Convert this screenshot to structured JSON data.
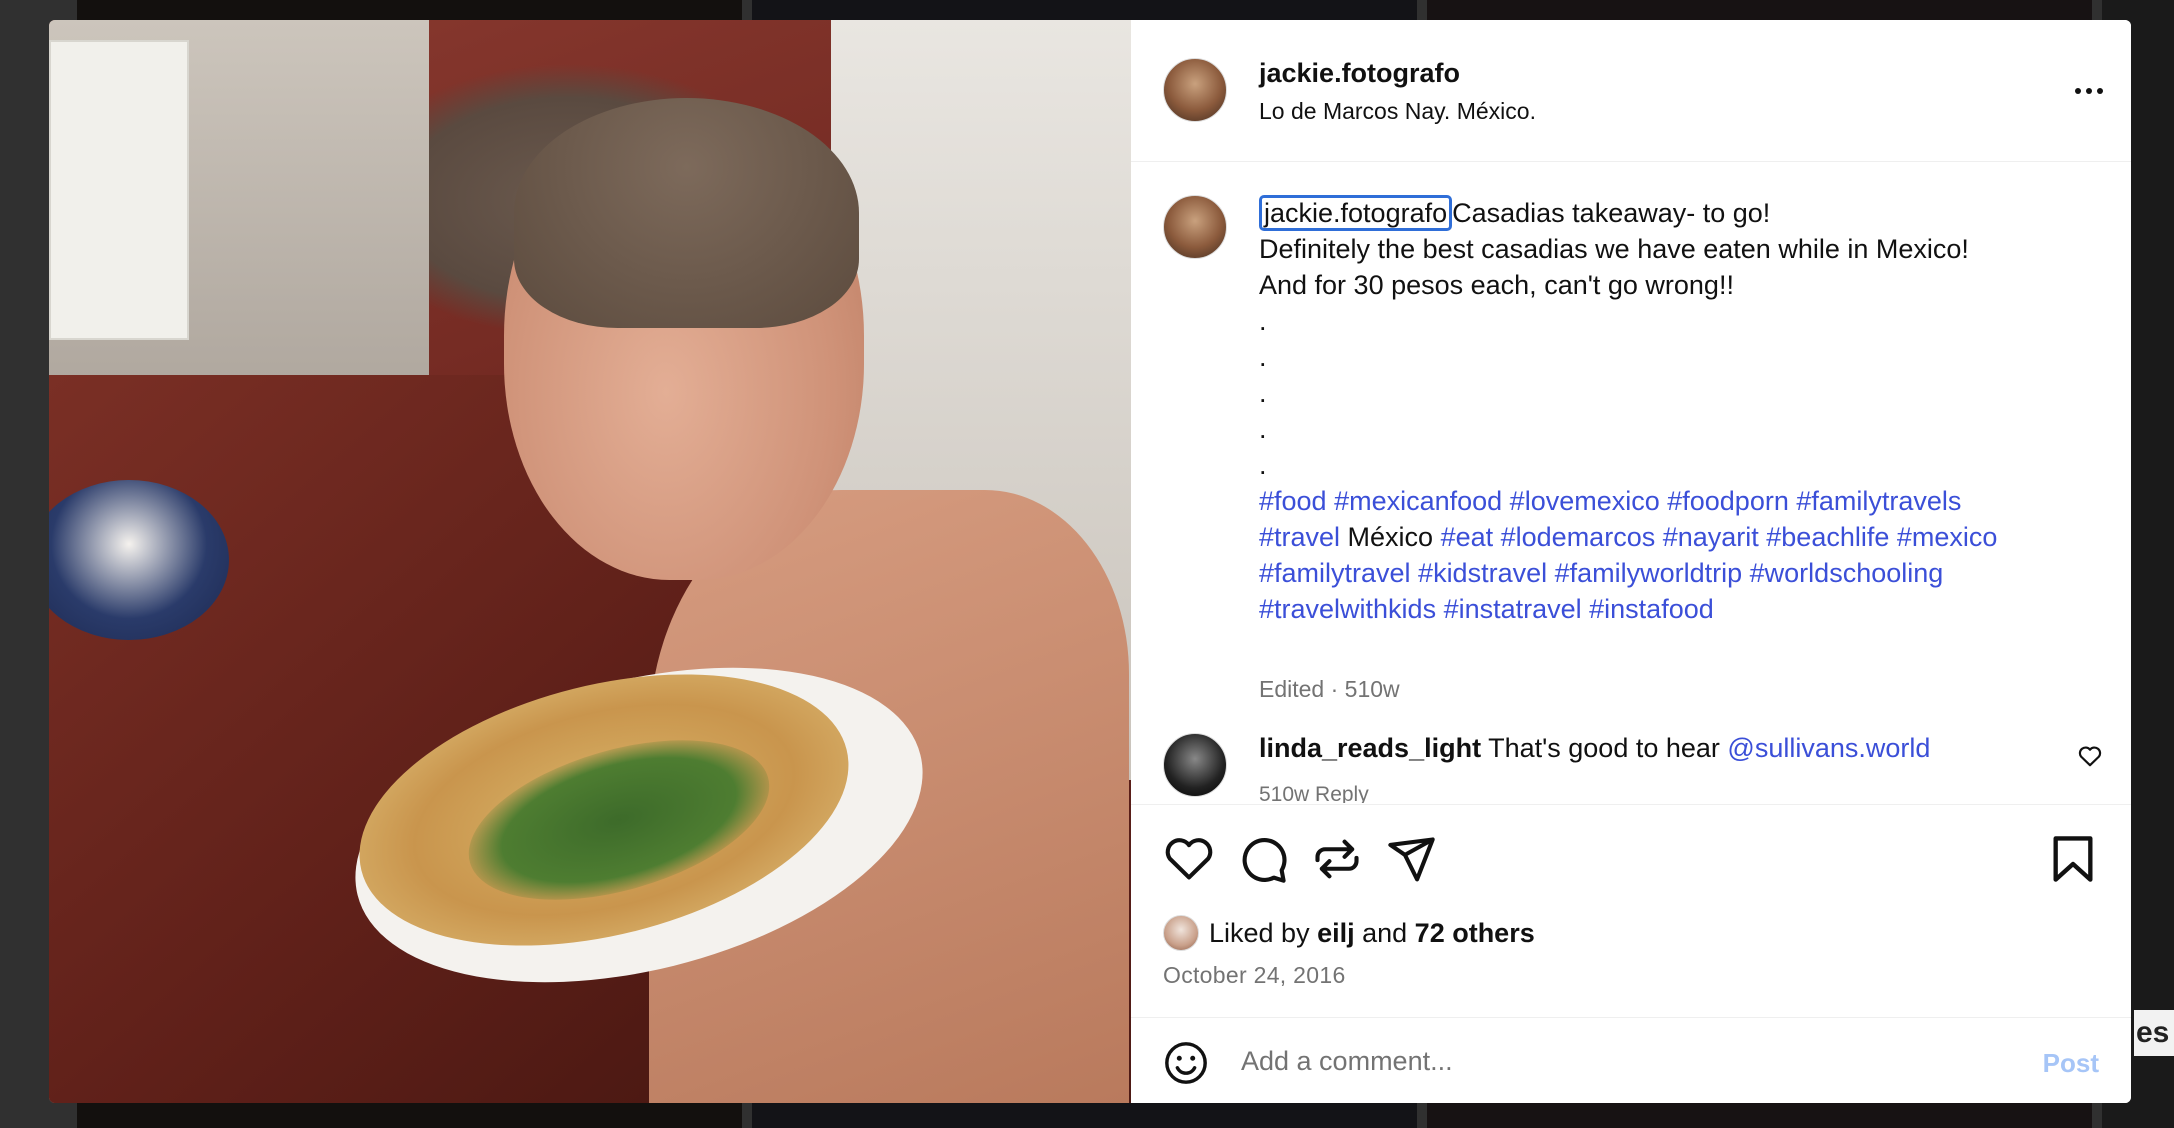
{
  "post": {
    "username": "jackie.fotografo",
    "location": "Lo de Marcos Nay. México.",
    "caption": {
      "mention": "jackie.fotografo",
      "line1": "Casadias takeaway- to go!",
      "line2": "Definitely the best casadias we have eaten while in Mexico!",
      "line3": "And for 30 pesos each, can't go wrong!!",
      "dots": [
        ".",
        ".",
        ".",
        ".",
        "."
      ],
      "hashtags_line1": "#food #mexicanfood #lovemexico #foodporn #familytravels",
      "hashtags_line2_a": "#travel",
      "hashtags_line2_plain": " México ",
      "hashtags_line2_b": "#eat #lodemarcos #nayarit #beachlife #mexico",
      "hashtags_line3": "#familytravel #kidstravel #familyworldtrip #worldschooling",
      "hashtags_line4": "#travelwithkids #instatravel #instafood"
    },
    "edited_meta": "Edited · 510w",
    "reply": {
      "username": "linda_reads_light",
      "text": "That's good to hear ",
      "mention": "@sullivans.world",
      "meta": "510w  Reply"
    },
    "likes": {
      "prefix": "Liked by ",
      "user": "eilj",
      "middle": " and ",
      "others": "72 others"
    },
    "date": "October 24, 2016",
    "comment_placeholder": "Add a comment...",
    "post_label": "Post"
  },
  "background": {
    "peek_text": "es"
  },
  "icons": {
    "more": "more-options-icon",
    "like": "heart-icon",
    "comment": "comment-icon",
    "repost": "repost-icon",
    "share": "share-icon",
    "save": "bookmark-icon",
    "emoji": "emoji-icon"
  },
  "colors": {
    "link": "#3b4fd8",
    "post_button": "#a6c5f7",
    "muted": "#737373"
  }
}
